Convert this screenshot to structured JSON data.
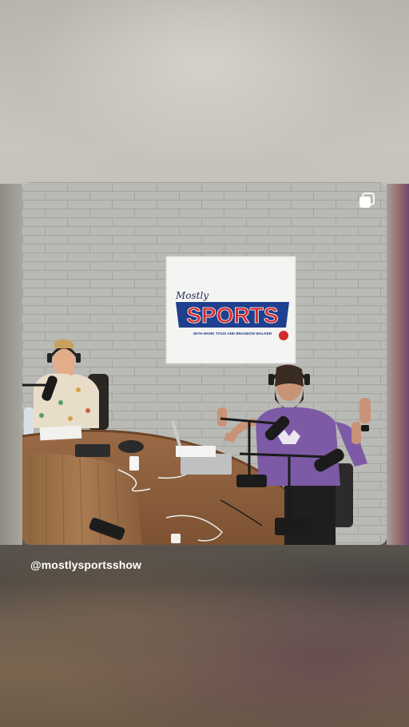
{
  "story": {
    "mention": "@mostlysportsshow",
    "sign": {
      "small_word": "Mostly",
      "big_word": "SPORTS",
      "tagline": "WITH MARK TITUS AND BRANDON WALKER"
    },
    "colors": {
      "sign_red": "#d32b2b",
      "sign_blue": "#1f3f8f",
      "shirt_purple": "#7d5aa6"
    },
    "icons": [
      "multi-post-icon"
    ]
  }
}
